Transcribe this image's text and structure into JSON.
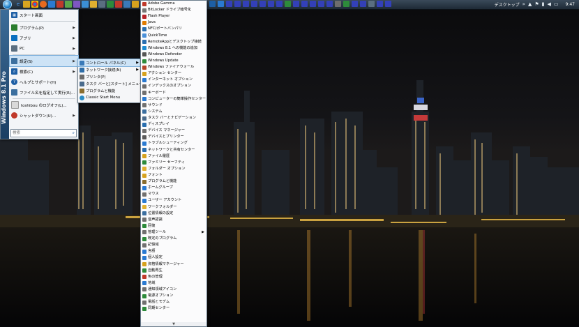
{
  "taskbar": {
    "tray_label": "デスクトップ",
    "clock": "9:47"
  },
  "start_menu": {
    "banner": "Windows 8.1 Pro",
    "items": [
      {
        "label": "スタート画面",
        "icon": "start-screen-icon",
        "color": "#1d5fa5",
        "arrow": false
      },
      {
        "label": "プログラム(P)",
        "icon": "programs-icon",
        "color": "#2a7d2e",
        "arrow": true
      },
      {
        "label": "アプリ",
        "icon": "apps-icon",
        "color": "#0a6fbf",
        "arrow": true
      },
      {
        "label": "PC",
        "icon": "pc-icon",
        "color": "#5a6e80",
        "arrow": true
      },
      {
        "label": "設定(S)",
        "icon": "settings-icon",
        "color": "#3b6f9f",
        "arrow": true
      },
      {
        "label": "検索(C)",
        "icon": "search-icon",
        "color": "#1d5fa5",
        "arrow": true
      },
      {
        "label": "ヘルプとサポート(H)",
        "icon": "help-icon",
        "color": "#1d5fa5",
        "arrow": false
      },
      {
        "label": "ファイル名を指定して実行(R)...",
        "icon": "run-icon",
        "color": "#3b6f9f",
        "arrow": false
      },
      {
        "label": "toshibou のログオフ(L)...",
        "icon": "logoff-icon",
        "color": "#c0392b",
        "arrow": false
      },
      {
        "label": "シャットダウン(U)...",
        "icon": "shutdown-icon",
        "color": "#c0392b",
        "arrow": true
      }
    ],
    "search_placeholder": "検索"
  },
  "settings_submenu": {
    "items": [
      {
        "label": "コントロール パネル(C)",
        "icon": "control-panel-icon",
        "color": "#3a7ab8",
        "arrow": true
      },
      {
        "label": "ネットワーク接続(N)",
        "icon": "network-icon",
        "color": "#2f6ea8",
        "arrow": true
      },
      {
        "label": "プリンタ(P)",
        "icon": "printer-icon",
        "color": "#6b6b6b",
        "arrow": false
      },
      {
        "label": "タスク バーと[スタート] メニュー(T)",
        "icon": "taskbar-icon",
        "color": "#4a6b8c",
        "arrow": false
      },
      {
        "label": "プログラムと機能",
        "icon": "programs-features-icon",
        "color": "#8a6e2f",
        "arrow": false
      },
      {
        "label": "Classic Start Menu",
        "icon": "classic-start-icon",
        "color": "#2a8cc4",
        "arrow": false
      }
    ]
  },
  "control_panel": {
    "items": [
      {
        "label": "Adobe Gamma",
        "color": "#c0392b"
      },
      {
        "label": "BitLocker ドライブ暗号化",
        "color": "#777777"
      },
      {
        "label": "Flash Player",
        "color": "#b8222a"
      },
      {
        "label": "Java",
        "color": "#e07b00"
      },
      {
        "label": "NFC/ポートバンパリ",
        "color": "#2a6fb0"
      },
      {
        "label": "QuickTime",
        "color": "#4a90d9"
      },
      {
        "label": "RemoteAppとデスクトップ接続",
        "color": "#2a6fb0"
      },
      {
        "label": "Windows 8.1 への機能の追加",
        "color": "#1d8bd1"
      },
      {
        "label": "Windows Defender",
        "color": "#555555"
      },
      {
        "label": "Windows Update",
        "color": "#2d8b3b"
      },
      {
        "label": "Windows ファイアウォール",
        "color": "#b5452a"
      },
      {
        "label": "アクション センター",
        "color": "#d6a21e"
      },
      {
        "label": "インターネット オプション",
        "color": "#2a7ad1"
      },
      {
        "label": "インデックスのオプション",
        "color": "#6d6d6d"
      },
      {
        "label": "キーボード",
        "color": "#707070"
      },
      {
        "label": "コンピューターの簡単操作センター",
        "color": "#2a7ad1"
      },
      {
        "label": "サウンド",
        "color": "#707070"
      },
      {
        "label": "システム",
        "color": "#3b6fa0"
      },
      {
        "label": "タスク バーとナビゲーション",
        "color": "#4a6b8c"
      },
      {
        "label": "ディスプレイ",
        "color": "#2a6fb0"
      },
      {
        "label": "デバイス マネージャー",
        "color": "#707070"
      },
      {
        "label": "デバイスとプリンター",
        "color": "#5a5a5a"
      },
      {
        "label": "トラブルシューティング",
        "color": "#2a7ad1"
      },
      {
        "label": "ネットワークと共有センター",
        "color": "#2a6fb0"
      },
      {
        "label": "ファイル履歴",
        "color": "#d6a21e"
      },
      {
        "label": "ファミリー セーフティ",
        "color": "#2d8b3b"
      },
      {
        "label": "フォルダー オプション",
        "color": "#e0b030"
      },
      {
        "label": "フォント",
        "color": "#d6a21e"
      },
      {
        "label": "プログラムと機能",
        "color": "#8a6e2f"
      },
      {
        "label": "ホームグループ",
        "color": "#2a7ad1"
      },
      {
        "label": "マウス",
        "color": "#707070"
      },
      {
        "label": "ユーザー アカウント",
        "color": "#2a7ad1"
      },
      {
        "label": "ワークフォルダー",
        "color": "#e0b030"
      },
      {
        "label": "位置情報の設定",
        "color": "#3b6fa0"
      },
      {
        "label": "音声認識",
        "color": "#707070"
      },
      {
        "label": "回復",
        "color": "#2d8b3b"
      },
      {
        "label": "管理ツール",
        "color": "#707070",
        "arrow": true
      },
      {
        "label": "既定のプログラム",
        "color": "#2d8b3b"
      },
      {
        "label": "記憶域",
        "color": "#707070"
      },
      {
        "label": "言語",
        "color": "#2a7ad1"
      },
      {
        "label": "個人設定",
        "color": "#2a7ad1"
      },
      {
        "label": "資格情報マネージャー",
        "color": "#d6a21e"
      },
      {
        "label": "自動再生",
        "color": "#2d8b3b"
      },
      {
        "label": "色の管理",
        "color": "#c0392b"
      },
      {
        "label": "地域",
        "color": "#2a7ad1"
      },
      {
        "label": "通知領域アイコン",
        "color": "#707070"
      },
      {
        "label": "電源オプション",
        "color": "#2d8b3b"
      },
      {
        "label": "電話とモデム",
        "color": "#707070"
      },
      {
        "label": "同期センター",
        "color": "#2d8b3b"
      }
    ]
  }
}
